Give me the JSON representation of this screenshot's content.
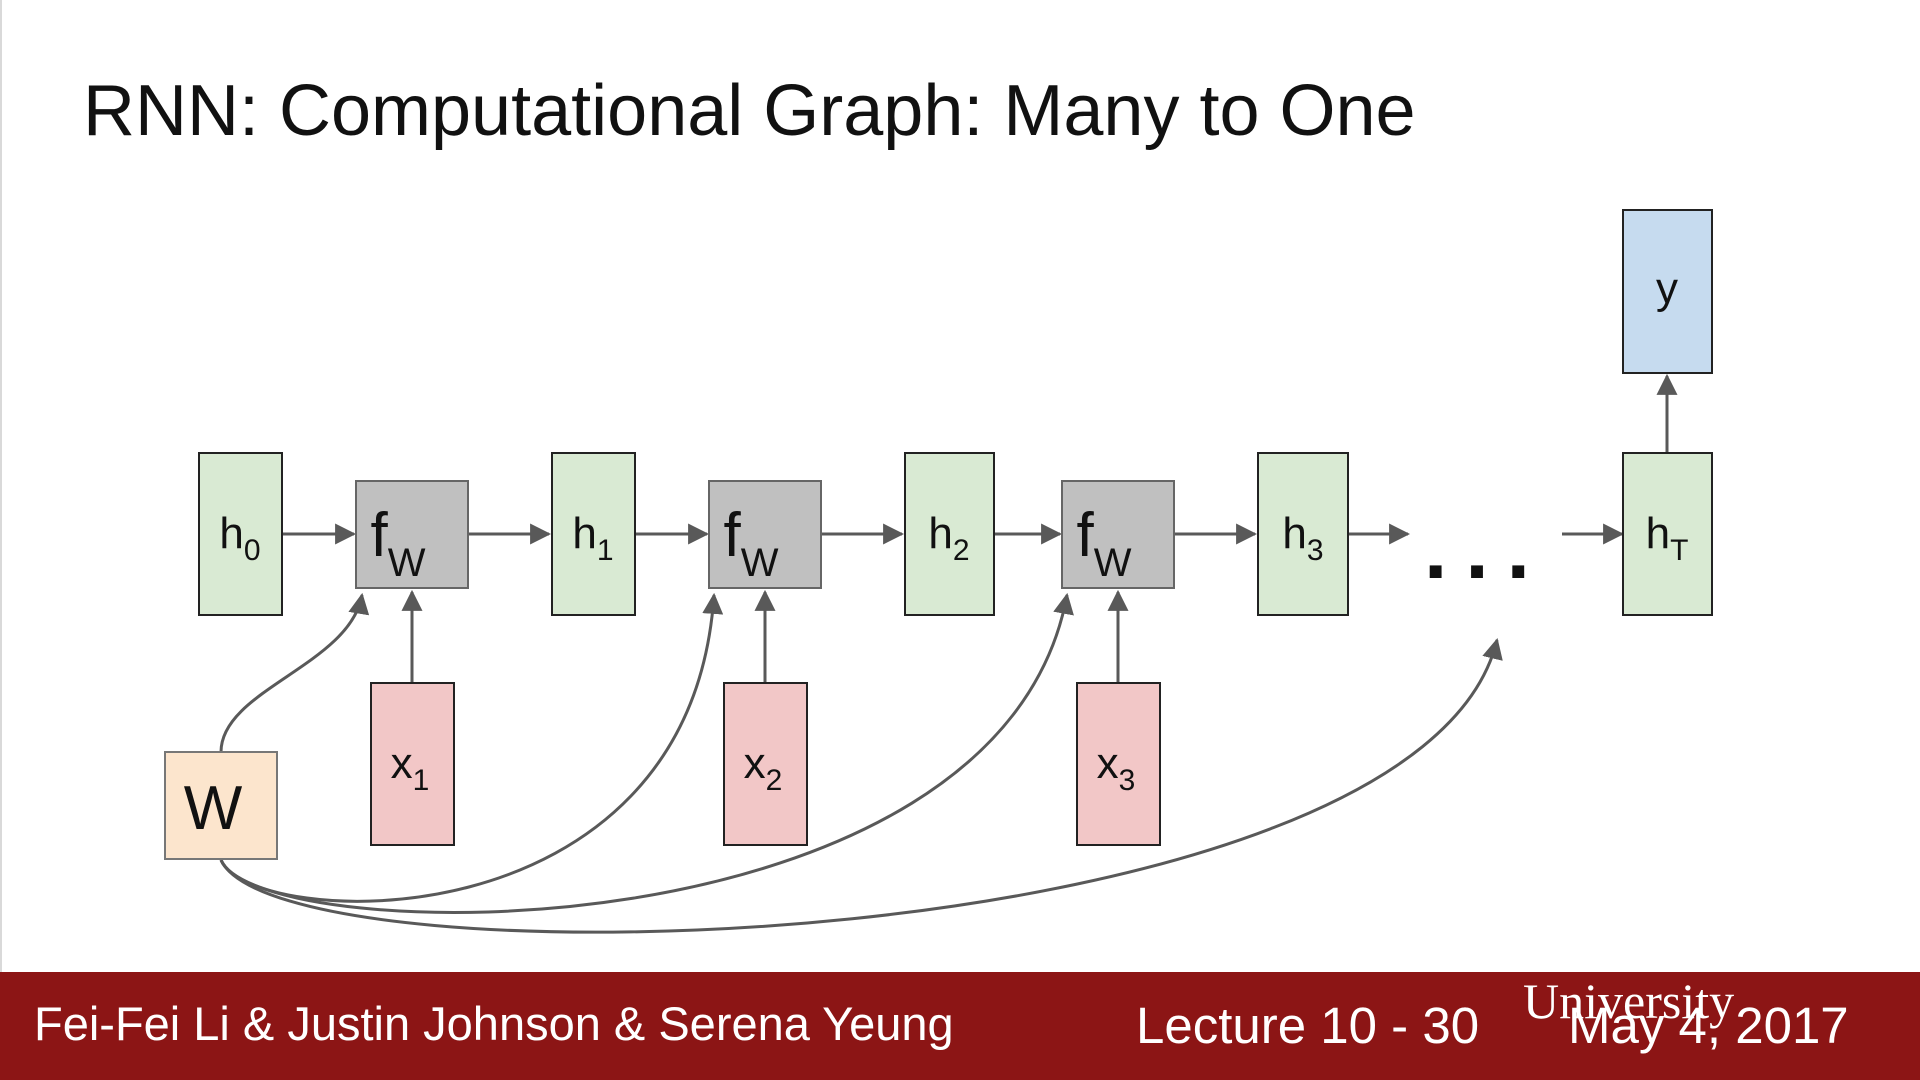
{
  "title": "RNN: Computational Graph: Many to One",
  "colors": {
    "hidden_fill": "#d9ead3",
    "fw_fill": "#c0c0c0",
    "input_fill": "#f2c7c7",
    "output_fill": "#c6dbef",
    "weight_fill": "#fce5cd",
    "edge": "#595959",
    "footer_bg": "#8c1515"
  },
  "nodes": {
    "h0": {
      "base": "h",
      "sub": "0"
    },
    "h1": {
      "base": "h",
      "sub": "1"
    },
    "h2": {
      "base": "h",
      "sub": "2"
    },
    "h3": {
      "base": "h",
      "sub": "3"
    },
    "hT": {
      "base": "h",
      "sub": "T"
    },
    "fw1": {
      "base": "f",
      "sub": "W"
    },
    "fw2": {
      "base": "f",
      "sub": "W"
    },
    "fw3": {
      "base": "f",
      "sub": "W"
    },
    "x1": {
      "base": "x",
      "sub": "1"
    },
    "x2": {
      "base": "x",
      "sub": "2"
    },
    "x3": {
      "base": "x",
      "sub": "3"
    },
    "y": {
      "base": "y"
    },
    "W": {
      "base": "W"
    }
  },
  "ellipsis": "...",
  "footer": {
    "authors": "Fei-Fei Li & Justin Johnson & Serena Yeung",
    "lecture": "Lecture 10 - 30",
    "date": "May 4, 2017",
    "watermark": "University"
  }
}
